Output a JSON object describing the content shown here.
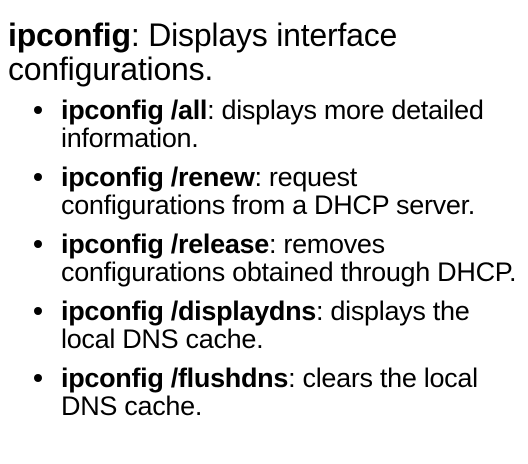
{
  "main": {
    "command": "ipconfig",
    "description": ": Displays interface configurations."
  },
  "bullets": [
    {
      "command": "ipconfig /all",
      "description": ": displays more detailed information."
    },
    {
      "command": "ipconfig /renew",
      "description": ": request configurations from a DHCP server."
    },
    {
      "command": "ipconfig /release",
      "description": ": removes configurations obtained through DHCP."
    },
    {
      "command": "ipconfig /displaydns",
      "description": ": displays the local DNS cache."
    },
    {
      "command": "ipconfig /flushdns",
      "description": ": clears the local DNS cache."
    }
  ]
}
